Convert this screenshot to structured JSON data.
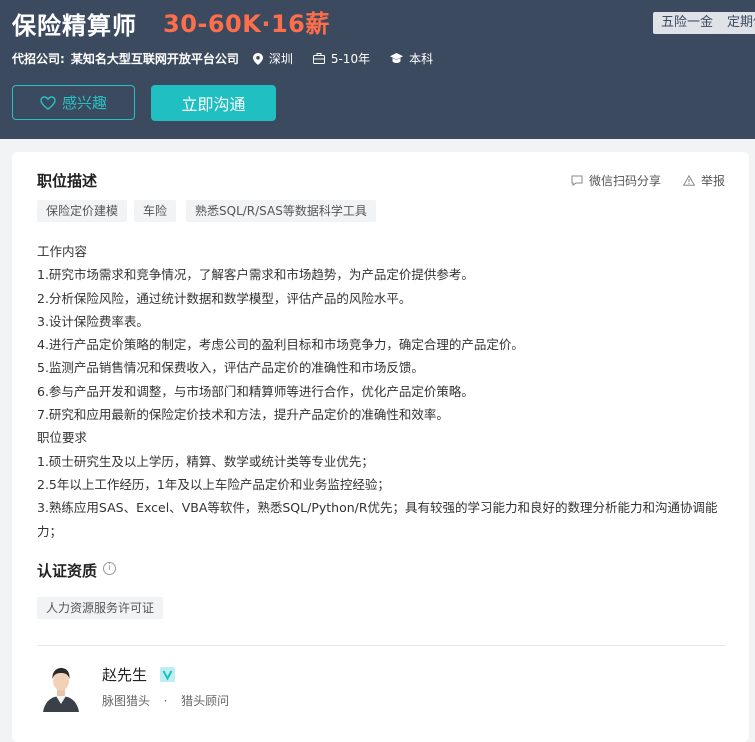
{
  "header": {
    "title": "保险精算师",
    "salary": "30-60K·16薪",
    "benefits": [
      "五险一金",
      "定期体检"
    ],
    "company_label": "代招公司:",
    "company": "某知名大型互联网开放平台公司",
    "location": "深圳",
    "experience": "5-10年",
    "education": "本科",
    "interest_button": "感兴趣",
    "chat_button": "立即沟通"
  },
  "description": {
    "section_title": "职位描述",
    "share_label": "微信扫码分享",
    "report_label": "举报",
    "tags": [
      "保险定价建模",
      "车险",
      "熟悉SQL/R/SAS等数据科学工具"
    ],
    "lines": [
      "工作内容",
      "1.研究市场需求和竞争情况，了解客户需求和市场趋势，为产品定价提供参考。",
      "2.分析保险风险，通过统计数据和数学模型，评估产品的风险水平。",
      "3.设计保险费率表。",
      "4.进行产品定价策略的制定，考虑公司的盈利目标和市场竞争力，确定合理的产品定价。",
      "5.监测产品销售情况和保费收入，评估产品定价的准确性和市场反馈。",
      "6.参与产品开发和调整，与市场部门和精算师等进行合作，优化产品定价策略。",
      "7.研究和应用最新的保险定价技术和方法，提升产品定价的准确性和效率。",
      "职位要求",
      "1.硕士研究生及以上学历，精算、数学或统计类等专业优先；",
      "2.5年以上工作经历，1年及以上车险产品定价和业务监控经验；",
      "3.熟练应用SAS、Excel、VBA等软件，熟悉SQL/Python/R优先；具有较强的学习能力和良好的数理分析能力和沟通协调能力；"
    ]
  },
  "certification": {
    "section_title": "认证资质",
    "info_icon": "i",
    "tags": [
      "人力资源服务许可证"
    ]
  },
  "recruiter": {
    "name": "赵先生",
    "company": "脉图猎头",
    "dot": "·",
    "role": "猎头顾问"
  },
  "colors": {
    "header_bg": "#3b4a5e",
    "salary": "#ff6e4a",
    "accent": "#1fbfc2"
  }
}
